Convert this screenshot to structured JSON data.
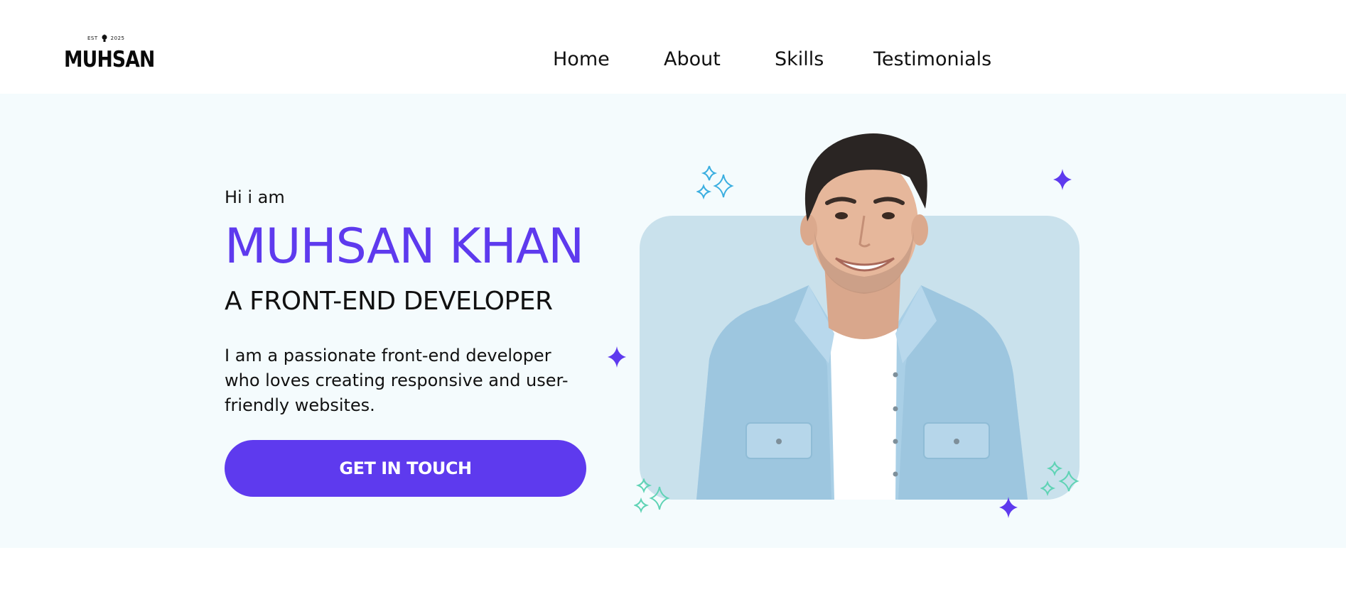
{
  "header": {
    "logo": {
      "est_text": "EST",
      "year_text": "2025",
      "name": "MUHSAN"
    },
    "nav": [
      {
        "label": "Home"
      },
      {
        "label": "About"
      },
      {
        "label": "Skills"
      },
      {
        "label": "Testimonials"
      }
    ]
  },
  "hero": {
    "greeting": "Hi i am",
    "name": "MUHSAN KHAN",
    "role": "A FRONT-END DEVELOPER",
    "description": "I am a passionate front-end developer who loves creating responsive and user-friendly websites.",
    "cta_label": "GET IN TOUCH",
    "photo_alt": "smiling man in denim shirt"
  },
  "colors": {
    "accent": "#5e3aee",
    "hero_bg": "#f4fbfd",
    "photo_bg": "#c9e1ec",
    "sparkle_blue": "#3aaee0",
    "sparkle_teal": "#5fd3b5"
  }
}
